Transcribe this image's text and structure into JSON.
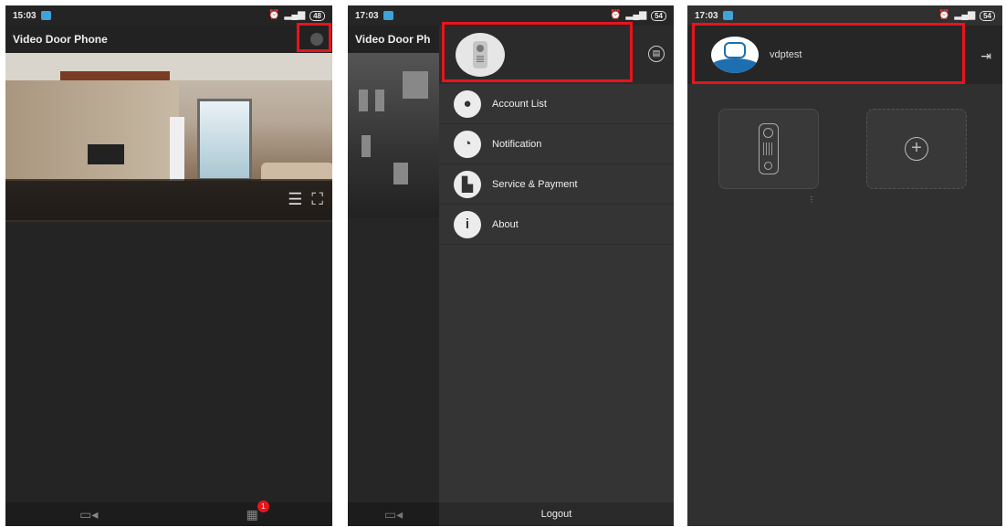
{
  "colors": {
    "highlight": "#e8141c",
    "background": "#242424"
  },
  "screen1": {
    "status": {
      "time": "15:03",
      "battery": "48"
    },
    "title": "Video Door Phone",
    "icons": {
      "settings": "settings-icon",
      "controls": [
        "sliders-icon",
        "fullscreen-icon"
      ],
      "nav": [
        "camera-icon",
        "calendar-icon"
      ]
    },
    "badge": "1"
  },
  "screen2": {
    "status": {
      "time": "17:03",
      "battery": "54"
    },
    "title": "Video Door Ph",
    "menu": [
      {
        "label": "Account List",
        "icon": "person-icon"
      },
      {
        "label": "Notification",
        "icon": "bell-icon"
      },
      {
        "label": "Service & Payment",
        "icon": "cart-icon"
      },
      {
        "label": "About",
        "icon": "info-icon"
      }
    ],
    "logout": "Logout"
  },
  "screen3": {
    "status": {
      "time": "17:03",
      "battery": "54"
    },
    "account": "vdptest"
  }
}
